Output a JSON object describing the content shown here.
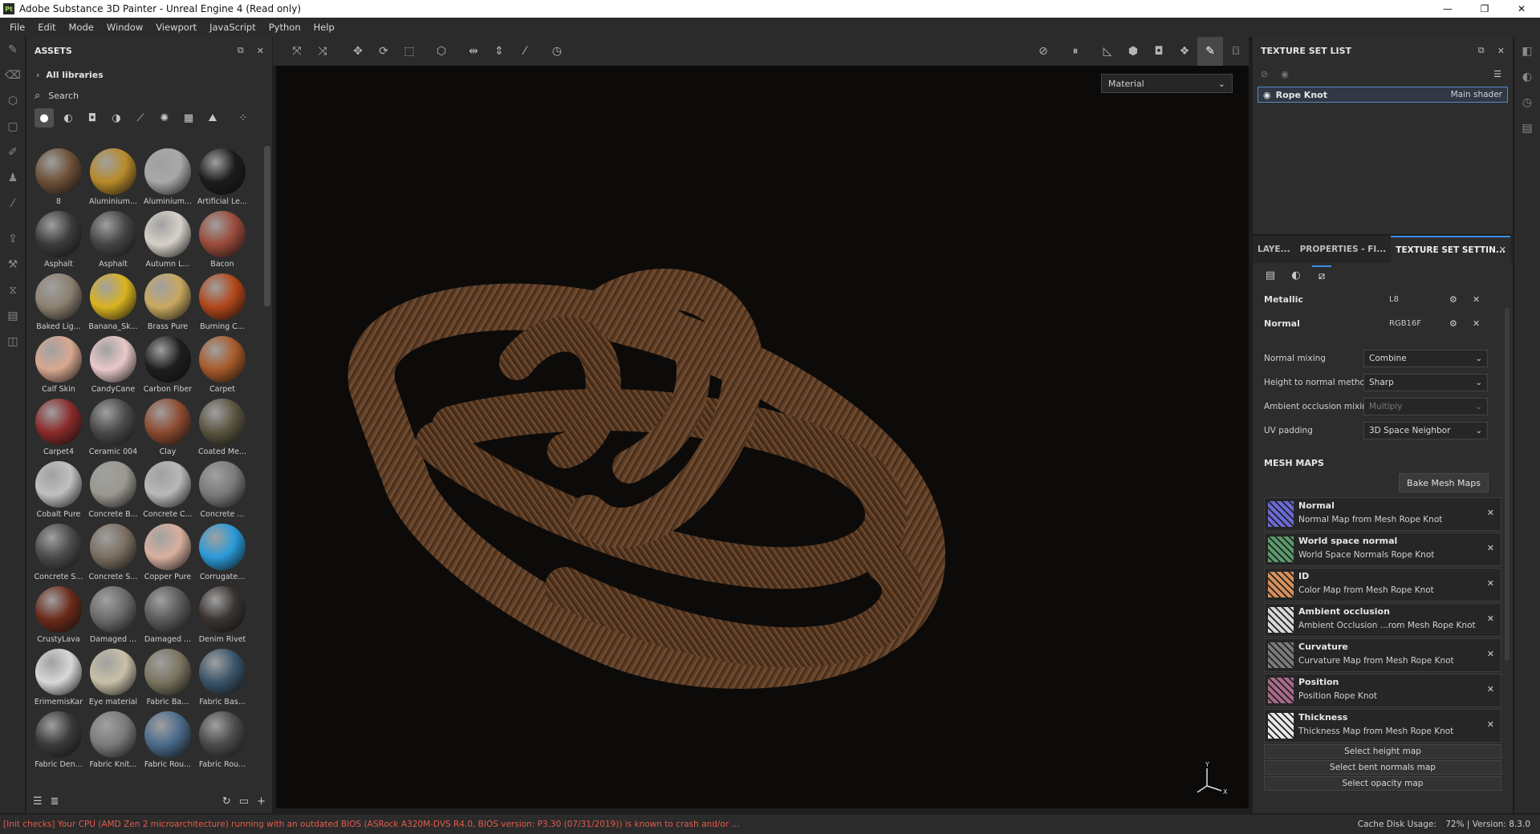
{
  "window": {
    "app_icon": "Pt",
    "title": "Adobe Substance 3D Painter - Unreal Engine 4 (Read only)",
    "minimize": "—",
    "maximize": "❐",
    "close": "✕"
  },
  "menu": [
    "File",
    "Edit",
    "Mode",
    "Window",
    "Viewport",
    "JavaScript",
    "Python",
    "Help"
  ],
  "assets": {
    "title": "ASSETS",
    "library": "All libraries",
    "search_placeholder": "Search",
    "items": [
      {
        "label": "8",
        "color": "#6b4f36"
      },
      {
        "label": "Aluminium...",
        "color": "#b88a2a"
      },
      {
        "label": "Aluminium...",
        "color": "#a8a8a8"
      },
      {
        "label": "Artificial Le...",
        "color": "#1c1c1c"
      },
      {
        "label": "Asphalt",
        "color": "#3b3b3b"
      },
      {
        "label": "Asphalt",
        "color": "#444444"
      },
      {
        "label": "Autumn L...",
        "color": "#d6d0c8"
      },
      {
        "label": "Bacon",
        "color": "#9a4a3a"
      },
      {
        "label": "Baked Lig...",
        "color": "#8c8070"
      },
      {
        "label": "Banana_Sk...",
        "color": "#d9b320"
      },
      {
        "label": "Brass Pure",
        "color": "#c8a860"
      },
      {
        "label": "Burning C...",
        "color": "#b2461a"
      },
      {
        "label": "Calf Skin",
        "color": "#d8a890"
      },
      {
        "label": "CandyCane",
        "color": "#e8c8c8"
      },
      {
        "label": "Carbon Fiber",
        "color": "#1e1e1e"
      },
      {
        "label": "Carpet",
        "color": "#a65a2a"
      },
      {
        "label": "Carpet4",
        "color": "#8a2a2a"
      },
      {
        "label": "Ceramic 004",
        "color": "#4a4a4a"
      },
      {
        "label": "Clay",
        "color": "#8c4a30"
      },
      {
        "label": "Coated Me...",
        "color": "#5a5440"
      },
      {
        "label": "Cobalt Pure",
        "color": "#c0c0c0"
      },
      {
        "label": "Concrete B...",
        "color": "#9a9890"
      },
      {
        "label": "Concrete C...",
        "color": "#b8b8b8"
      },
      {
        "label": "Concrete ...",
        "color": "#7a7a7a"
      },
      {
        "label": "Concrete S...",
        "color": "#4a4a4a"
      },
      {
        "label": "Concrete S...",
        "color": "#7a6e60"
      },
      {
        "label": "Copper Pure",
        "color": "#d8b0a0"
      },
      {
        "label": "Corrugate...",
        "color": "#2a9ad8"
      },
      {
        "label": "CrustyLava",
        "color": "#6a2a1a"
      },
      {
        "label": "Damaged ...",
        "color": "#6a6a6a"
      },
      {
        "label": "Damaged ...",
        "color": "#5a5a5a"
      },
      {
        "label": "Denim Rivet",
        "color": "#3a3430"
      },
      {
        "label": "ErimemisKar",
        "color": "#d8d8d8"
      },
      {
        "label": "Eye material",
        "color": "#c8c0a8"
      },
      {
        "label": "Fabric Ba...",
        "color": "#7a7460"
      },
      {
        "label": "Fabric Bas...",
        "color": "#3a5468"
      },
      {
        "label": "Fabric Den...",
        "color": "#3a3a3a"
      },
      {
        "label": "Fabric Knit...",
        "color": "#7a7a7a"
      },
      {
        "label": "Fabric Rou...",
        "color": "#4a6a8a"
      },
      {
        "label": "Fabric Rou...",
        "color": "#4a4a4a"
      },
      {
        "label": "",
        "color": "#5a3a2a"
      },
      {
        "label": "",
        "color": "#4a4a4a"
      },
      {
        "label": "",
        "color": "#b8b8b8"
      },
      {
        "label": "",
        "color": "#8a6a50"
      }
    ]
  },
  "viewport": {
    "material_select": "Material"
  },
  "texture_set_list": {
    "title": "TEXTURE SET LIST",
    "set_name": "Rope Knot",
    "shader": "Main shader"
  },
  "texture_set_settings": {
    "tabs": [
      "LAYE...",
      "PROPERTIES - FI...",
      "TEXTURE SET SETTIN..."
    ],
    "channels": [
      {
        "name": "Metallic",
        "format": "L8"
      },
      {
        "name": "Normal",
        "format": "RGB16F"
      }
    ],
    "props": [
      {
        "label": "Normal mixing",
        "value": "Combine",
        "disabled": false
      },
      {
        "label": "Height to normal method",
        "value": "Sharp",
        "disabled": false
      },
      {
        "label": "Ambient occlusion mixing",
        "value": "Multiply",
        "disabled": true
      },
      {
        "label": "UV padding",
        "value": "3D Space Neighbor",
        "disabled": false
      }
    ],
    "mesh_maps_title": "MESH MAPS",
    "bake_button": "Bake Mesh Maps",
    "mesh_maps": [
      {
        "title": "Normal",
        "sub": "Normal Map from Mesh Rope Knot",
        "color": "#6a6ad8"
      },
      {
        "title": "World space normal",
        "sub": "World Space Normals Rope Knot",
        "color": "#5a9a6a"
      },
      {
        "title": "ID",
        "sub": "Color Map from Mesh Rope Knot",
        "color": "#d8905a"
      },
      {
        "title": "Ambient occlusion",
        "sub": "Ambient Occlusion ...rom Mesh Rope Knot",
        "color": "#d8d8d8"
      },
      {
        "title": "Curvature",
        "sub": "Curvature Map from Mesh Rope Knot",
        "color": "#7a7a7a"
      },
      {
        "title": "Position",
        "sub": "Position Rope Knot",
        "color": "#a86a8a"
      },
      {
        "title": "Thickness",
        "sub": "Thickness Map from Mesh Rope Knot",
        "color": "#e8e8e8"
      }
    ],
    "select_buttons": [
      "Select height map",
      "Select bent normals map",
      "Select opacity map"
    ]
  },
  "status": {
    "warning": "[Init checks] Your CPU (AMD Zen 2 microarchitecture) running with an outdated BIOS (ASRock A320M-DVS R4.0, BIOS version: P3.30 (07/31/2019)) is known to crash and/or ...",
    "cache": "Cache Disk Usage:",
    "cache_value": "72%",
    "version": "| Version: 8.3.0"
  }
}
